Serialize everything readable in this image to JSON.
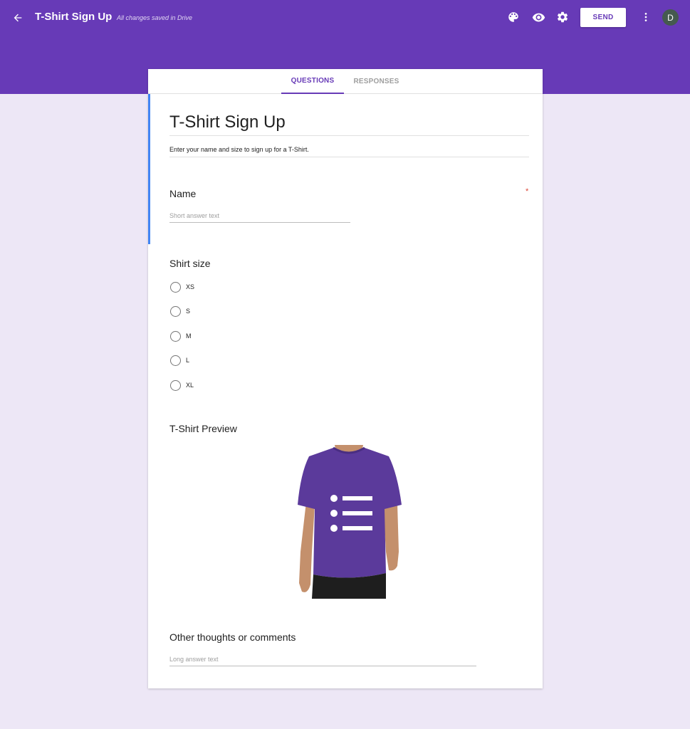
{
  "app": {
    "title": "T-Shirt Sign Up",
    "save_status": "All changes saved in Drive",
    "send_label": "SEND",
    "avatar_initial": "D",
    "accent_color": "#673ab7",
    "background_color": "#ede7f6",
    "icons": [
      "back-arrow-icon",
      "palette-icon",
      "preview-eye-icon",
      "settings-gear-icon",
      "more-vert-icon"
    ]
  },
  "tabs": [
    {
      "label": "QUESTIONS",
      "active": true
    },
    {
      "label": "RESPONSES",
      "active": false
    }
  ],
  "form": {
    "title": "T-Shirt Sign Up",
    "description": "Enter your name and size to sign up for a T-Shirt."
  },
  "questions": [
    {
      "title": "Name",
      "required_mark": "*",
      "placeholder": "Short answer text"
    },
    {
      "title": "Shirt size",
      "options": [
        "XS",
        "S",
        "M",
        "L",
        "XL"
      ]
    },
    {
      "title": "T-Shirt Preview"
    },
    {
      "title": "Other thoughts or comments",
      "placeholder": "Long answer text"
    }
  ]
}
